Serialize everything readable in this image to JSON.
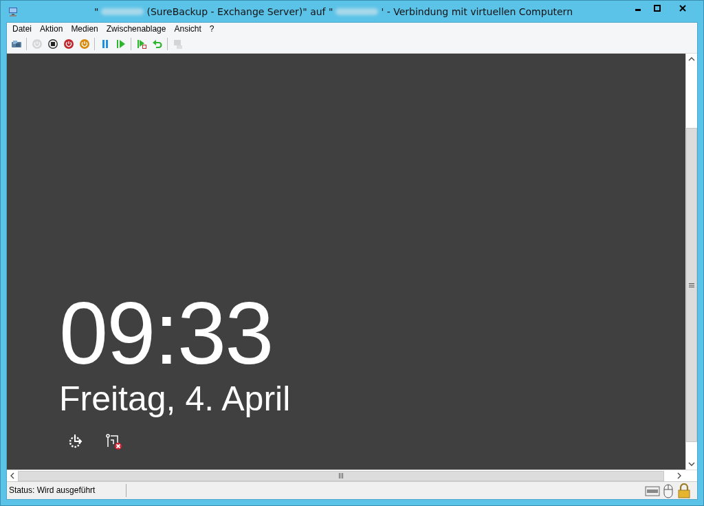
{
  "window": {
    "title_parts": [
      {
        "kind": "text",
        "text": "\""
      },
      {
        "kind": "redacted"
      },
      {
        "kind": "text",
        "text": "(SureBackup - Exchange Server)\" auf \""
      },
      {
        "kind": "redacted"
      },
      {
        "kind": "text",
        "text": "' - Verbindung mit virtuellen Computern"
      }
    ]
  },
  "menu": [
    "Datei",
    "Aktion",
    "Medien",
    "Zwischenablage",
    "Ansicht",
    "?"
  ],
  "toolbar": [
    {
      "kind": "keys",
      "disabled": false
    },
    {
      "kind": "separator"
    },
    {
      "kind": "start",
      "disabled": true
    },
    {
      "kind": "stop",
      "disabled": false
    },
    {
      "kind": "shutdown",
      "disabled": false
    },
    {
      "kind": "save",
      "disabled": false
    },
    {
      "kind": "separator"
    },
    {
      "kind": "pause",
      "disabled": false
    },
    {
      "kind": "resume",
      "disabled": false
    },
    {
      "kind": "separator"
    },
    {
      "kind": "checkpoint",
      "disabled": false
    },
    {
      "kind": "revert",
      "disabled": false
    },
    {
      "kind": "separator"
    },
    {
      "kind": "session",
      "disabled": true
    }
  ],
  "lock_screen": {
    "time": "09:33",
    "date": "Freitag, 4. April"
  },
  "status_bar": {
    "status": "Status: Wird ausgeführt"
  }
}
